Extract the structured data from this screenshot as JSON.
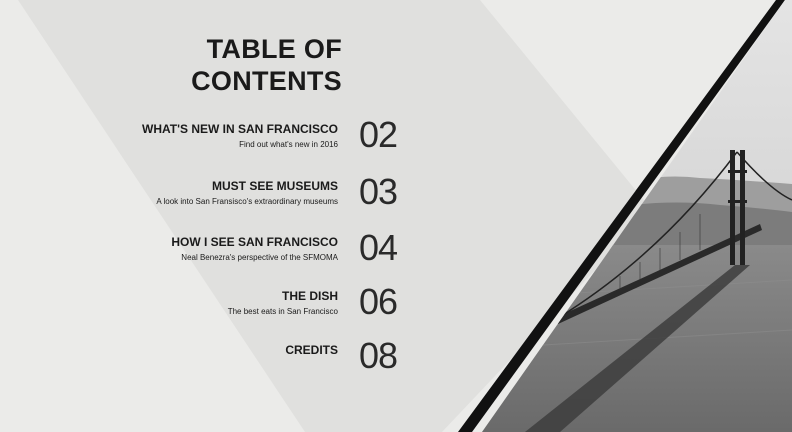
{
  "title_line1": "TABLE OF",
  "title_line2": "CONTENTS",
  "entries": [
    {
      "title": "WHAT'S NEW IN SAN FRANCISCO",
      "description": "Find out what's new in 2016",
      "page": "02"
    },
    {
      "title": "MUST SEE MUSEUMS",
      "description": "A look into San Fransisco's extraordinary museums",
      "page": "03"
    },
    {
      "title": "HOW I SEE SAN FRANCISCO",
      "description": "Neal Benezra's perspective of the SFMOMA",
      "page": "04"
    },
    {
      "title": "THE DISH",
      "description": "The best eats in San Francisco",
      "page": "06"
    },
    {
      "title": "CREDITS",
      "description": "",
      "page": "08"
    }
  ],
  "colors": {
    "background": "#ebebe9",
    "panel": "#e0e0de",
    "text": "#1a1a1a",
    "stripe": "#000000"
  },
  "image": {
    "subject": "golden-gate-bridge-photo",
    "style": "grayscale"
  }
}
